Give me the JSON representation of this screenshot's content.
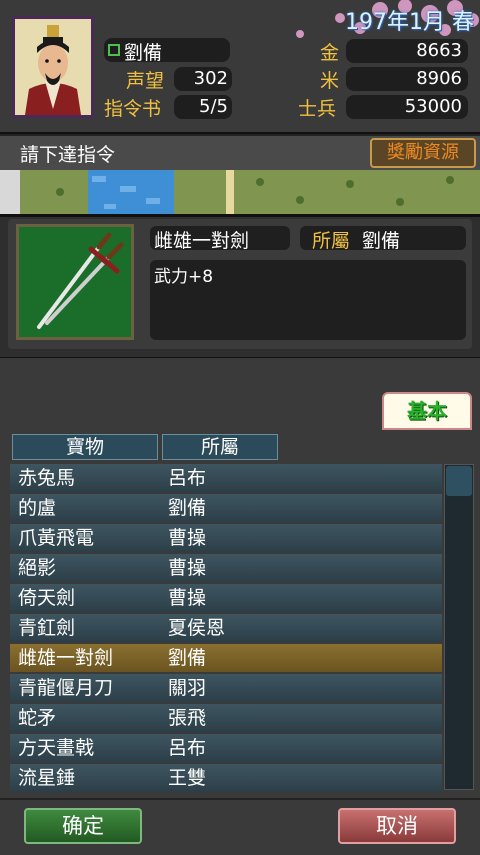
{
  "header": {
    "date": "197年1月 春",
    "ruler_name": "劉備",
    "stats_left": [
      {
        "label": "声望",
        "value": "302"
      },
      {
        "label": "指令书",
        "value": "5/5"
      }
    ],
    "stats_right": [
      {
        "label": "金",
        "value": "8663"
      },
      {
        "label": "米",
        "value": "8906"
      },
      {
        "label": "士兵",
        "value": "53000"
      }
    ]
  },
  "command": {
    "prompt": "請下達指令",
    "reward_button": "獎勵資源"
  },
  "item": {
    "name": "雌雄一對劍",
    "owner_label": "所屬",
    "owner": "劉備",
    "description": "武力+8",
    "icon": "twin-swords-icon"
  },
  "list": {
    "tab_label": "基本",
    "columns": [
      "寶物",
      "所屬"
    ],
    "rows": [
      {
        "item": "赤兔馬",
        "owner": "呂布"
      },
      {
        "item": "的盧",
        "owner": "劉備"
      },
      {
        "item": "爪黃飛電",
        "owner": "曹操"
      },
      {
        "item": "絕影",
        "owner": "曹操"
      },
      {
        "item": "倚天劍",
        "owner": "曹操"
      },
      {
        "item": "青釭劍",
        "owner": "夏侯恩"
      },
      {
        "item": "雌雄一對劍",
        "owner": "劉備"
      },
      {
        "item": "青龍偃月刀",
        "owner": "關羽"
      },
      {
        "item": "蛇矛",
        "owner": "張飛"
      },
      {
        "item": "方天畫戟",
        "owner": "呂布"
      },
      {
        "item": "流星錘",
        "owner": "王雙"
      }
    ],
    "selected_index": 6
  },
  "footer": {
    "confirm": "确定",
    "cancel": "取消"
  },
  "colors": {
    "gold_label": "#f0c040",
    "selected_row": "#8a7030",
    "confirm_bg": "#3f8a3f",
    "cancel_bg": "#c87070"
  }
}
